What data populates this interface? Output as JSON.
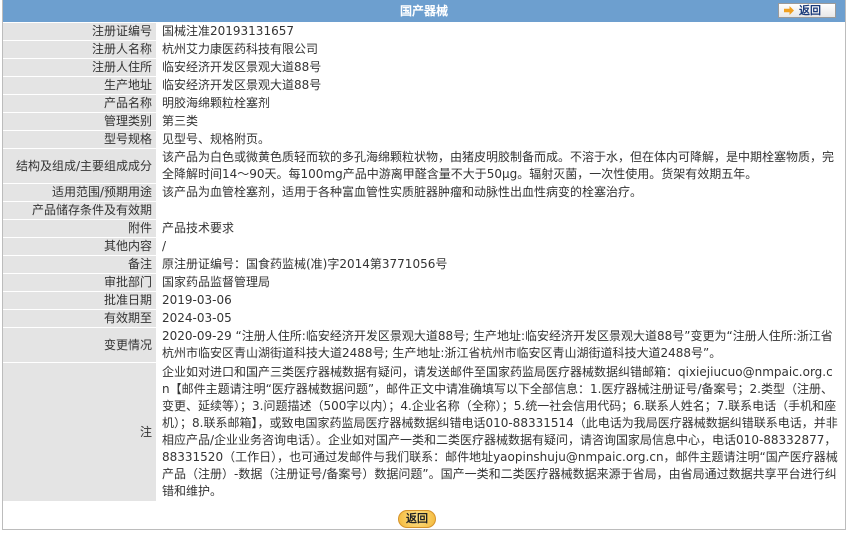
{
  "header": {
    "title": "国产器械",
    "back_label": "返回"
  },
  "rows": [
    {
      "label": "注册证编号",
      "value": "国械注准20193131657"
    },
    {
      "label": "注册人名称",
      "value": "杭州艾力康医药科技有限公司"
    },
    {
      "label": "注册人住所",
      "value": "临安经济开发区景观大道88号"
    },
    {
      "label": "生产地址",
      "value": "临安经济开发区景观大道88号"
    },
    {
      "label": "产品名称",
      "value": "明胶海绵颗粒栓塞剂"
    },
    {
      "label": "管理类别",
      "value": "第三类"
    },
    {
      "label": "型号规格",
      "value": "见型号、规格附页。"
    },
    {
      "label": "结构及组成/主要组成成分",
      "value": "该产品为白色或微黄色质轻而软的多孔海绵颗粒状物，由猪皮明胶制备而成。不溶于水，但在体内可降解，是中期栓塞物质，完全降解时间14～90天。每100mg产品中游离甲醛含量不大于50μg。辐射灭菌，一次性使用。货架有效期五年。"
    },
    {
      "label": "适用范围/预期用途",
      "value": "该产品为血管栓塞剂，适用于各种富血管性实质脏器肿瘤和动脉性出血性病变的栓塞治疗。"
    },
    {
      "label": "产品储存条件及有效期",
      "value": ""
    },
    {
      "label": "附件",
      "value": "产品技术要求"
    },
    {
      "label": "其他内容",
      "value": "/"
    },
    {
      "label": "备注",
      "value": "原注册证编号：国食药监械(准)字2014第3771056号"
    },
    {
      "label": "审批部门",
      "value": "国家药品监督管理局"
    },
    {
      "label": "批准日期",
      "value": "2019-03-06"
    },
    {
      "label": "有效期至",
      "value": "2024-03-05"
    },
    {
      "label": "变更情况",
      "value": "2020-09-29 “注册人住所:临安经济开发区景观大道88号; 生产地址:临安经济开发区景观大道88号”变更为“注册人住所:浙江省杭州市临安区青山湖街道科技大道2488号; 生产地址:浙江省杭州市临安区青山湖街道科技大道2488号”。"
    },
    {
      "label": "注",
      "value": "企业如对进口和国产三类医疗器械数据有疑问，请发送邮件至国家药监局医疗器械数据纠错邮箱：qixiejiucuo@nmpaic.org.cn【邮件主题请注明“医疗器械数据问题”，邮件正文中请准确填写以下全部信息：1.医疗器械注册证号/备案号；2.类型（注册、变更、延续等）；3.问题描述（500字以内）；4.企业名称（全称）；5.统一社会信用代码；6.联系人姓名；7.联系电话（手机和座机）；8.联系邮箱】，或致电国家药监局医疗器械数据纠错电话010-88331514（此电话为我局医疗器械数据纠错联系电话，并非相应产品/企业业务咨询电话）。企业如对国产一类和二类医疗器械数据有疑问，请咨询国家局信息中心，电话010-88332877，88331520（工作日），也可通过发邮件与我们联系：邮件地址yaopinshuju@nmpaic.org.cn，邮件主题请注明“国产医疗器械产品（注册）-数据（注册证号/备案号）数据问题”。国产一类和二类医疗器械数据来源于省局，由省局通过数据共享平台进行纠错和维护。"
    }
  ],
  "footer": {
    "back_label": "返回"
  }
}
